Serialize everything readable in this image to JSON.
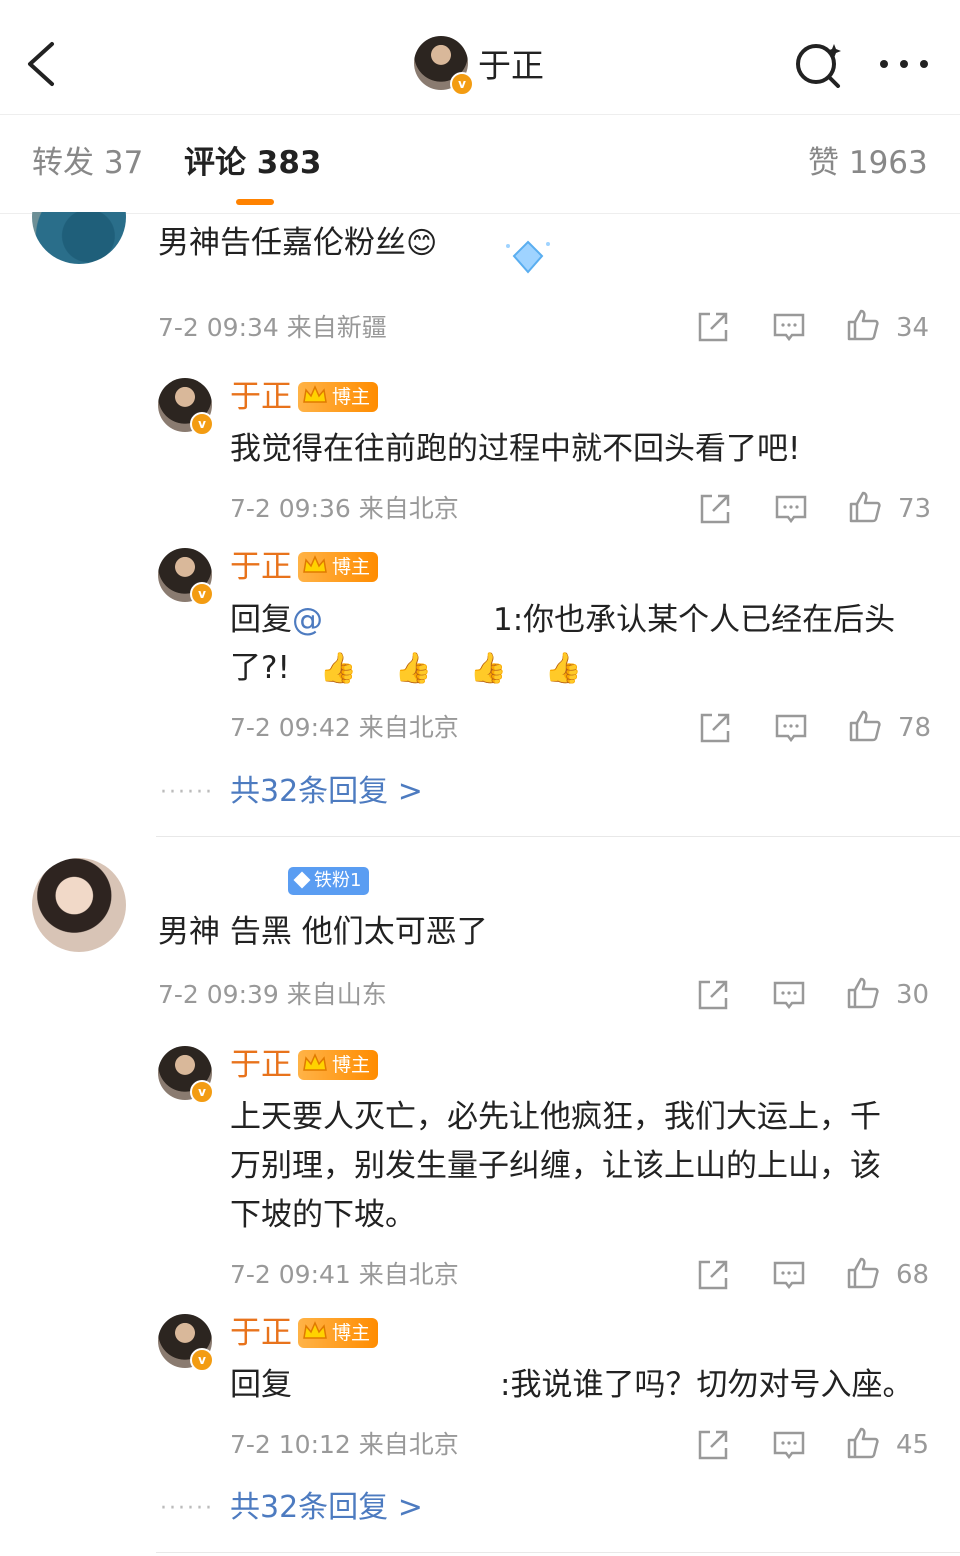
{
  "header": {
    "name": "于正",
    "v_badge": "v"
  },
  "tabs": [
    {
      "label": "转发 37"
    },
    {
      "label": "评论 383"
    },
    {
      "label": "赞 1963"
    }
  ],
  "thread1": {
    "comment": {
      "text": "男神告任嘉伦粉丝",
      "emoji": "😊",
      "meta": "7-2 09:34  来自新疆",
      "likes": "34"
    },
    "replies": [
      {
        "name": "于正",
        "badge": "博主",
        "text": "我觉得在往前跑的过程中就不回头看了吧!",
        "meta": "7-2 09:36  来自北京",
        "likes": "73"
      },
      {
        "name": "于正",
        "badge": "博主",
        "prefix": "回复",
        "mention": "@",
        "suffix": "1:你也承认某个人已经在后头",
        "line2": "了?!",
        "emojis": "👍 👍 👍 👍",
        "meta": "7-2 09:42  来自北京",
        "likes": "78"
      }
    ],
    "more": "共32条回复 >",
    "dots": "······"
  },
  "thread2": {
    "comment": {
      "fan_badge": "铁粉1",
      "text": "男神 告黑 他们太可恶了",
      "meta": "7-2 09:39  来自山东",
      "likes": "30"
    },
    "replies": [
      {
        "name": "于正",
        "badge": "博主",
        "line1": "上天要人灭亡，必先让他疯狂，我们大运上，千",
        "line2": "万别理，别发生量子纠缠，让该上山的上山，该",
        "line3": "下坡的下坡。",
        "meta": "7-2 09:41  来自北京",
        "likes": "68"
      },
      {
        "name": "于正",
        "badge": "博主",
        "prefix": "回复",
        "suffix": ":我说谁了吗？切勿对号入座。",
        "meta": "7-2 10:12  来自北京",
        "likes": "45"
      }
    ],
    "more": "共32条回复 >",
    "dots": "······"
  },
  "colors": {
    "accent": "#ff8200",
    "name": "#e8731c",
    "link": "#4d7bc0",
    "meta": "#999999"
  },
  "icons": [
    "back-icon",
    "search-icon",
    "more-icon",
    "share-icon",
    "comment-icon",
    "like-icon",
    "crown-icon",
    "diamond-icon"
  ]
}
